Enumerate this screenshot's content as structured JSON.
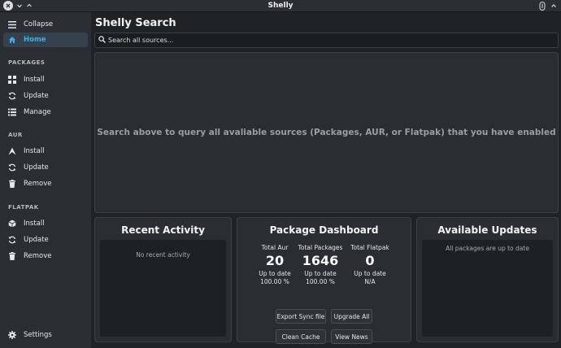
{
  "window": {
    "title": "Shelly"
  },
  "sidebar": {
    "collapse_label": "Collapse",
    "home_label": "Home",
    "packages": {
      "header": "PACKAGES",
      "items": [
        "Install",
        "Update",
        "Manage"
      ]
    },
    "aur": {
      "header": "AUR",
      "items": [
        "Install",
        "Update",
        "Remove"
      ]
    },
    "flatpak": {
      "header": "FLATPAK",
      "items": [
        "Install",
        "Update",
        "Remove"
      ]
    },
    "settings_label": "Settings"
  },
  "main": {
    "title": "Shelly Search",
    "search_placeholder": "Search all sources...",
    "results_message": "Search above to query all avaliable sources (Packages, AUR, or Flatpak) that you have enabled"
  },
  "recent_activity": {
    "title": "Recent Activity",
    "empty_text": "No recent activity"
  },
  "dashboard": {
    "title": "Package Dashboard",
    "stats": [
      {
        "label": "Total Aur",
        "value": "20",
        "status": "Up to date",
        "percent": "100.00 %"
      },
      {
        "label": "Total Packages",
        "value": "1646",
        "status": "Up to date",
        "percent": "100.00 %"
      },
      {
        "label": "Total Flatpak",
        "value": "0",
        "status": "Up to date",
        "percent": "N/A"
      }
    ],
    "buttons": {
      "export_sync": "Export Sync file",
      "upgrade_all": "Upgrade All",
      "clean_cache": "Clean Cache",
      "view_news": "View News"
    }
  },
  "updates": {
    "title": "Available Updates",
    "status_text": "All packages are up to date"
  },
  "colors": {
    "accent": "#3daee9",
    "background": "#202326",
    "panel": "#2a2e32"
  }
}
